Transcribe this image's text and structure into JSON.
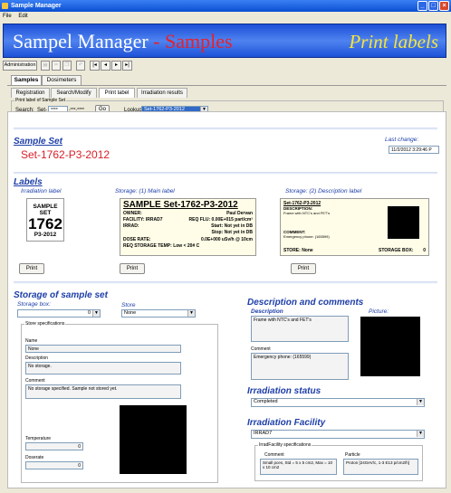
{
  "window": {
    "title": "Sample Manager",
    "menu": [
      "File",
      "Edit"
    ]
  },
  "banner": {
    "title_a": "Sampel Manager",
    "title_b": " - Samples",
    "right": "Print labels"
  },
  "toolbar": {
    "admin": "Administration"
  },
  "tabs": {
    "main": [
      "Samples",
      "Dosimeters"
    ],
    "sub": [
      "Registration",
      "Search/Modify",
      "Print label",
      "Irradiation results"
    ]
  },
  "printset": {
    "legend": "Print label of Sample Set",
    "search_label": "Search:",
    "search_prefix": "Set-",
    "search_val1": "****",
    "search_mid": "-***-****",
    "go": "Go",
    "lookup_label": "Lookup:",
    "lookup_val": "Set-1762-P3-2012"
  },
  "sampleset": {
    "header": "Sample Set",
    "id": "Set-1762-P3-2012",
    "lastchange_label": "Last change:",
    "lastchange": "11/2/2012 3:29:46 P"
  },
  "labels": {
    "header": "Labels",
    "irr_title": "Irradiation label",
    "irr_l1": "SAMPLE SET",
    "irr_num": "1762",
    "irr_l3": "P3-2012",
    "main_title": "Storage: (1) Main label",
    "main_head": "SAMPLE  Set-1762-P3-2012",
    "owner_l": "OWNER:",
    "owner_v": "Paul Dervan",
    "facility_l": "FACILITY:  IRRAD7",
    "reqflu": "REQ FLU: 0.00E+015 part/cm²",
    "irrad_l": "IRRAD:",
    "start": "Start: Not yet in DB",
    "stop": "Stop: Not yet in DB",
    "dose_l": "DOSE RATE:",
    "dose_v": "0.0E+000 uSv/h @ 10cm",
    "temp": "REQ STORAGE TEMP:   Low < 20# C",
    "desc_title": "Storage: (2) Description label",
    "desc_id": "Set-1762-P3-2012",
    "desc_l": "DESCRIPTION:",
    "desc_v": "Frame with NTC's and FET's",
    "comment_l": "COMMENT:",
    "comment_v": "Emergency phone: (165599)",
    "store_l": "STORE:  None",
    "storebox_l": "STORAGE BOX:",
    "storebox_v": "0",
    "print": "Print"
  },
  "storage": {
    "header": "Storage of sample set",
    "box_label": "Storage box:",
    "box_val": "0",
    "store_label": "Store",
    "store_val": "None",
    "spec_legend": "Store specifications",
    "name_l": "Name",
    "name_v": "None",
    "desc_l": "Description",
    "desc_v": "No storage.",
    "comment_l": "Comment",
    "comment_v": "No storage specified. Sample not stored yet.",
    "temp_l": "Temperature",
    "temp_v": "0",
    "dose_l": "Doserate",
    "dose_v": "0"
  },
  "descr": {
    "header": "Description and comments",
    "desc_l": "Description",
    "desc_v": "Frame with NTC's and FET's",
    "picture_l": "Picture:",
    "comment_l": "Comment",
    "comment_v": "Emergency phone: (165599)"
  },
  "irrstatus": {
    "header": "Irradiation status",
    "value": "Completed"
  },
  "irrfac": {
    "header": "Irradiation Facility",
    "value": "IRRAD7",
    "spec_legend": "IrradFacility specifications",
    "comment_l": "Comment",
    "comment_v": "Small pces, Std = 5 x 5 cm2, Max = 10 x 10 cm2",
    "particle_l": "Particle",
    "particle_v": "Proton [24GeV/c, 1-3 E13 p/cm2/h]"
  }
}
